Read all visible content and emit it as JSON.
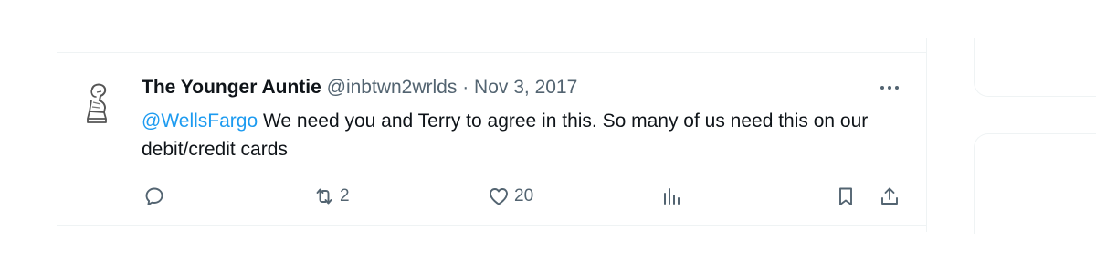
{
  "tweet": {
    "author": {
      "display_name": "The Younger Auntie",
      "handle": "@inbtwn2wrlds",
      "avatar_icon": "sketch-figure-avatar"
    },
    "separator": "·",
    "date": "Nov 3, 2017",
    "more_icon": "more-horizontal-icon",
    "text": {
      "mention": "@WellsFargo",
      "body": " We need you and Terry to agree in this. So many of us need this on our debit/credit cards"
    },
    "actions": {
      "reply": {
        "icon": "reply-icon",
        "count": ""
      },
      "retweet": {
        "icon": "retweet-icon",
        "count": "2"
      },
      "like": {
        "icon": "heart-icon",
        "count": "20"
      },
      "views": {
        "icon": "analytics-icon",
        "count": ""
      },
      "bookmark": {
        "icon": "bookmark-icon"
      },
      "share": {
        "icon": "share-icon"
      }
    }
  },
  "colors": {
    "text_primary": "#0f1419",
    "text_secondary": "#536471",
    "link": "#1d9bf0",
    "border": "#eff3f4"
  }
}
